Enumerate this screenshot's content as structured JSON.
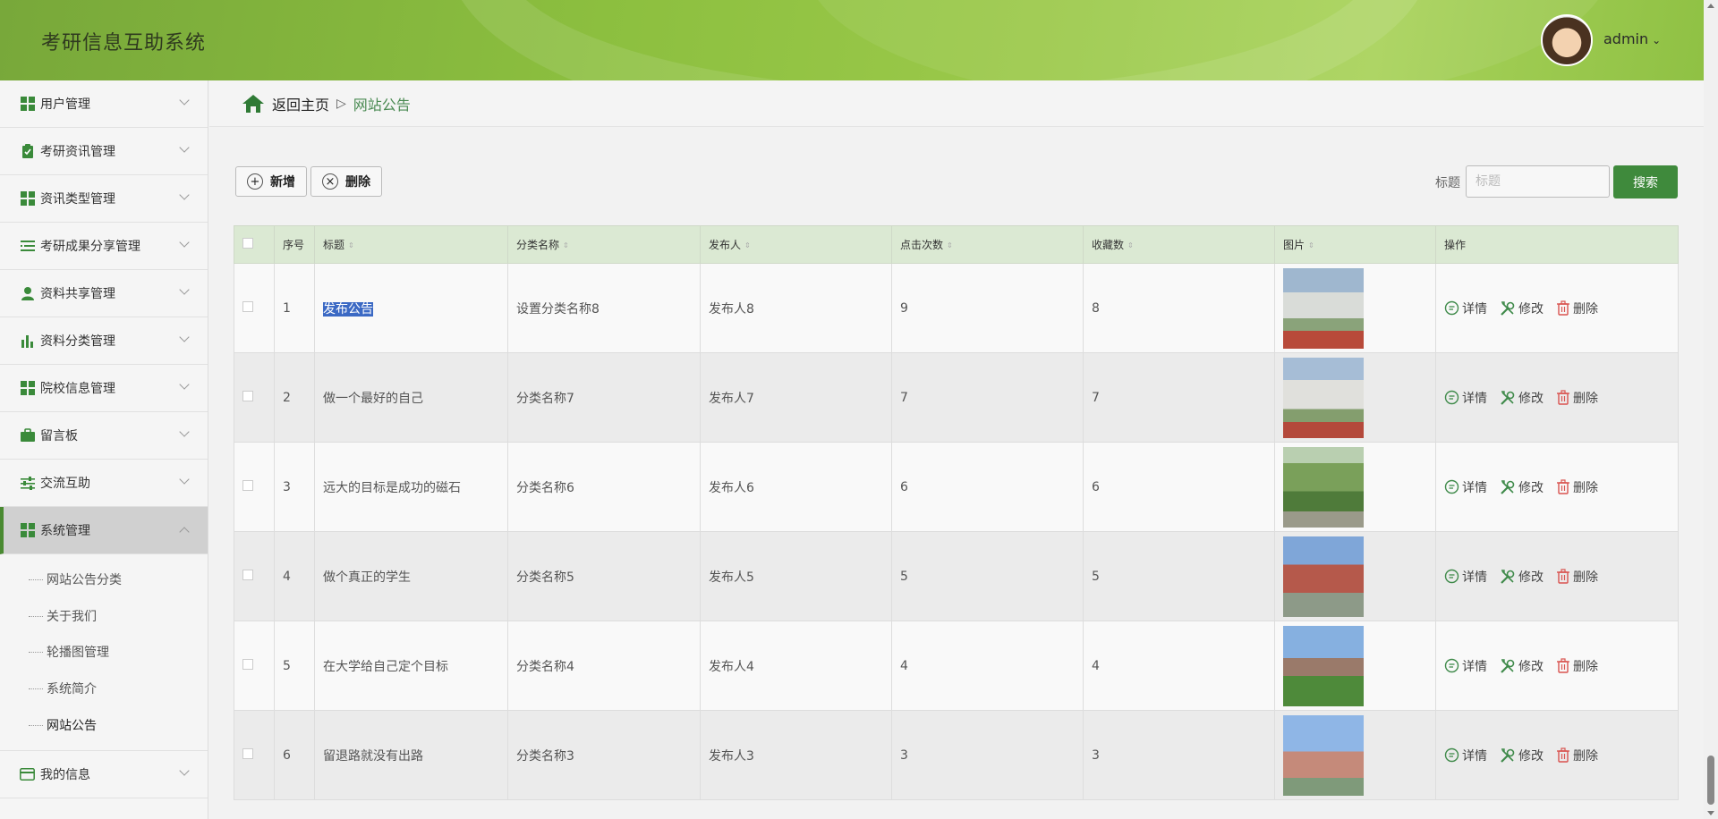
{
  "header": {
    "app_title": "考研信息互助系统",
    "username": "admin",
    "chevron": "⌄"
  },
  "sidebar": {
    "items": [
      {
        "label": "用户管理",
        "icon": "grid-icon"
      },
      {
        "label": "考研资讯管理",
        "icon": "clipboard-icon"
      },
      {
        "label": "资讯类型管理",
        "icon": "grid-icon"
      },
      {
        "label": "考研成果分享管理",
        "icon": "list-icon"
      },
      {
        "label": "资料共享管理",
        "icon": "user-icon"
      },
      {
        "label": "资料分类管理",
        "icon": "bar-chart-icon"
      },
      {
        "label": "院校信息管理",
        "icon": "grid-icon"
      },
      {
        "label": "留言板",
        "icon": "briefcase-icon"
      },
      {
        "label": "交流互助",
        "icon": "sliders-icon"
      },
      {
        "label": "系统管理",
        "icon": "grid-icon"
      }
    ],
    "submenu": [
      "网站公告分类",
      "关于我们",
      "轮播图管理",
      "系统简介",
      "网站公告"
    ],
    "last_item": {
      "label": "我的信息",
      "icon": "card-icon"
    }
  },
  "breadcrumb": {
    "home": "返回主页",
    "separator": "▷",
    "current": "网站公告"
  },
  "toolbar": {
    "add_label": "新增",
    "delete_label": "删除",
    "search_label": "标题",
    "search_placeholder": "标题",
    "search_button": "搜索"
  },
  "table": {
    "columns": [
      "序号",
      "标题",
      "分类名称",
      "发布人",
      "点击次数",
      "收藏数",
      "图片",
      "操作"
    ],
    "rows": [
      {
        "no": "1",
        "title": "发布公告",
        "category": "设置分类名称8",
        "publisher": "发布人8",
        "clicks": "9",
        "favorites": "8"
      },
      {
        "no": "2",
        "title": "做一个最好的自己",
        "category": "分类名称7",
        "publisher": "发布人7",
        "clicks": "7",
        "favorites": "7"
      },
      {
        "no": "3",
        "title": "远大的目标是成功的磁石",
        "category": "分类名称6",
        "publisher": "发布人6",
        "clicks": "6",
        "favorites": "6"
      },
      {
        "no": "4",
        "title": "做个真正的学生",
        "category": "分类名称5",
        "publisher": "发布人5",
        "clicks": "5",
        "favorites": "5"
      },
      {
        "no": "5",
        "title": "在大学给自己定个目标",
        "category": "分类名称4",
        "publisher": "发布人4",
        "clicks": "4",
        "favorites": "4"
      },
      {
        "no": "6",
        "title": "留退路就没有出路",
        "category": "分类名称3",
        "publisher": "发布人3",
        "clicks": "3",
        "favorites": "3"
      }
    ],
    "actions": {
      "detail": "详情",
      "edit": "修改",
      "delete": "删除"
    }
  },
  "colors": {
    "accent": "#3f8a3c",
    "header_green": "#8cbf3f",
    "table_header": "#dbe9d3",
    "selection": "#3b69c4"
  }
}
